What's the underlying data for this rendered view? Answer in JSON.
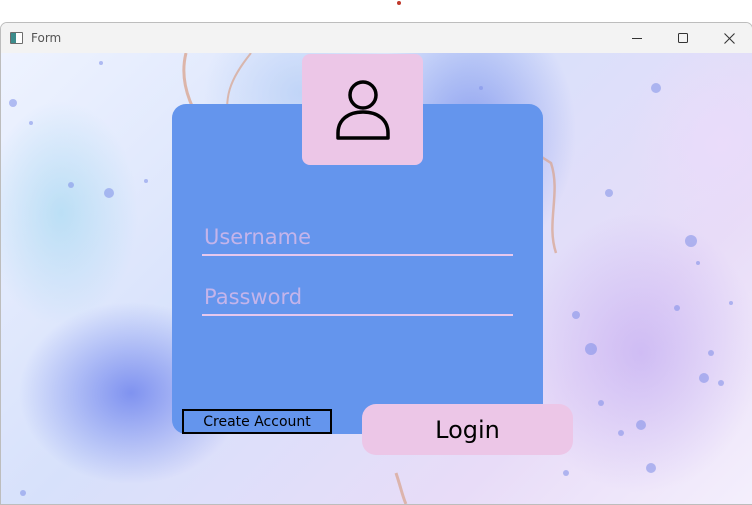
{
  "window": {
    "title": "Form",
    "app_icon": "form-window-icon",
    "controls": [
      "minimize-icon",
      "maximize-icon",
      "close-icon"
    ]
  },
  "login": {
    "avatar_icon": "user-icon",
    "username_placeholder": "Username",
    "username_value": "",
    "password_placeholder": "Password",
    "password_value": "",
    "create_account_label": "Create Account",
    "login_label": "Login"
  },
  "colors": {
    "card": "#6495ed",
    "accent_pink": "#ecc6e7",
    "underline": "#e6c8ee",
    "placeholder": "#c4b4ea"
  }
}
